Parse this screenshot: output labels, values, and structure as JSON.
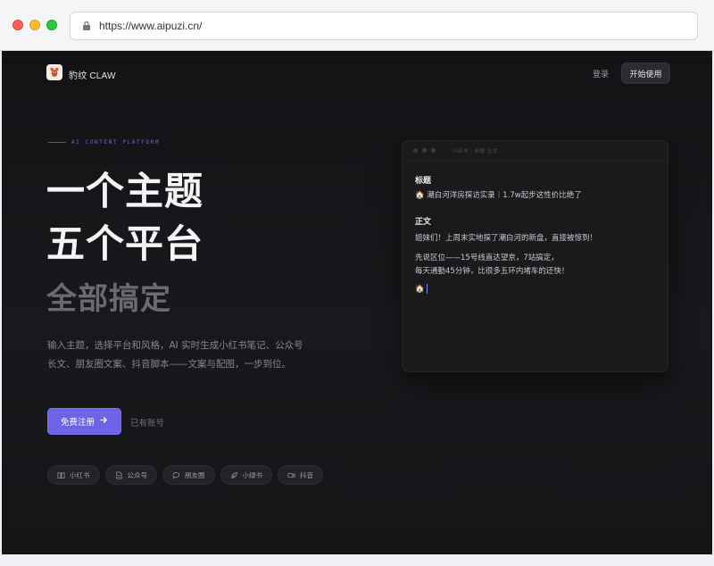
{
  "browser": {
    "url": "https://www.aipuzi.cn/"
  },
  "nav": {
    "logo_text": "豹纹 CLAW",
    "login_label": "登录",
    "start_label": "开始使用"
  },
  "hero": {
    "eyebrow": "AI CONTENT PLATFORM",
    "title_line1": "一个主题",
    "title_line2": "五个平台",
    "title_line3": "全部搞定",
    "description": "输入主题，选择平台和风格，AI 实时生成小红书笔记、公众号长文、朋友圈文案、抖音脚本——文案与配图，一步到位。",
    "cta_label": "免费注册",
    "have_account": "已有账号"
  },
  "platform_tags": [
    {
      "label": "小红书",
      "icon": "book-icon"
    },
    {
      "label": "公众号",
      "icon": "document-icon"
    },
    {
      "label": "朋友圈",
      "icon": "chat-icon"
    },
    {
      "label": "小绿书",
      "icon": "leaf-icon"
    },
    {
      "label": "抖音",
      "icon": "video-icon"
    }
  ],
  "editor": {
    "meta": "小红书 · 标题 正文",
    "title_label": "标题",
    "title_value": "🏠 潮白河洋房探访实录｜1.7w起步这性价比绝了",
    "body_label": "正文",
    "body_line1": "姐妹们！上周末实地探了潮白河的新盘，直接被惊到！",
    "body_line2": "先说区位——15号线直达望京，7站搞定，",
    "body_line3": "每天通勤45分钟，比很多五环内堵车的还快！",
    "body_line4": "🏠"
  },
  "colors": {
    "accent": "#6c63e6",
    "background": "#141417"
  }
}
